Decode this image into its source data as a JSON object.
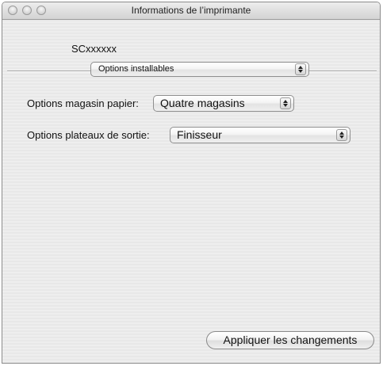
{
  "window": {
    "title": "Informations de l’imprimante"
  },
  "printer": {
    "name": "SCxxxxxx"
  },
  "section_popup": {
    "selected": "Options installables"
  },
  "fields": {
    "magasin": {
      "label": "Options magasin papier:",
      "selected": "Quatre magasins"
    },
    "plateaux": {
      "label": "Options plateaux de sortie:",
      "selected": "Finisseur"
    }
  },
  "actions": {
    "apply_label": "Appliquer les changements"
  }
}
